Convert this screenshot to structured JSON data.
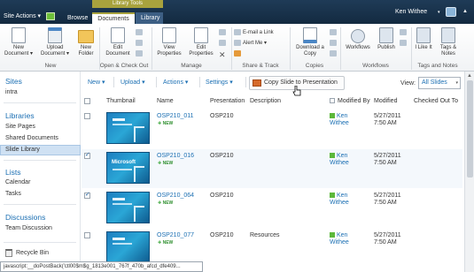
{
  "topbar": {
    "site_actions": "Site Actions ▾",
    "tabs": {
      "browse": "Browse",
      "documents": "Documents",
      "library": "Library"
    },
    "context_label": "Library Tools",
    "user_name": "Ken Withee",
    "user_caret": "▾"
  },
  "ribbon": {
    "new_document": "New Document ▾",
    "upload_document": "Upload Document ▾",
    "new_folder": "New Folder",
    "edit_document": "Edit Document",
    "view_properties": "View Properties",
    "edit_properties": "Edit Properties",
    "email_link": "E-mail a Link",
    "alert_me": "Alert Me ▾",
    "download_copy": "Download a Copy",
    "workflows": "Workflows",
    "publish": "Publish",
    "i_like_it": "I Like It",
    "tags_notes": "Tags & Notes",
    "groups": {
      "new": "New",
      "open_checkout": "Open & Check Out",
      "manage": "Manage",
      "share_track": "Share & Track",
      "copies": "Copies",
      "workflows": "Workflows",
      "tags_notes": "Tags and Notes"
    }
  },
  "leftnav": {
    "sites_heading": "Sites",
    "sites": [
      "intra"
    ],
    "libraries_heading": "Libraries",
    "libraries": [
      "Site Pages",
      "Shared Documents",
      "Slide Library"
    ],
    "lists_heading": "Lists",
    "lists": [
      "Calendar",
      "Tasks"
    ],
    "discussions_heading": "Discussions",
    "discussions": [
      "Team Discussion"
    ],
    "recycle_bin": "Recycle Bin"
  },
  "toolbar": {
    "new": "New ▾",
    "upload": "Upload ▾",
    "actions": "Actions ▾",
    "settings": "Settings ▾",
    "copy_slide": "Copy Slide to Presentation",
    "view_label": "View:",
    "view_value": "All Slides",
    "view_caret": "▾"
  },
  "columns": {
    "thumbnail": "Thumbnail",
    "name": "Name",
    "presentation": "Presentation",
    "description": "Description",
    "modified_by": "Modified By",
    "modified": "Modified",
    "checked_out_to": "Checked Out To"
  },
  "rows": [
    {
      "name": "OSP210_011",
      "new": "NEW",
      "presentation": "OSP210",
      "description": "",
      "modified_by_1": "Ken",
      "modified_by_2": "Withee",
      "date": "5/27/2011",
      "time": "7:50 AM",
      "checked": false,
      "thumb_title": ""
    },
    {
      "name": "OSP210_016",
      "new": "NEW",
      "presentation": "OSP210",
      "description": "",
      "modified_by_1": "Ken",
      "modified_by_2": "Withee",
      "date": "5/27/2011",
      "time": "7:50 AM",
      "checked": true,
      "thumb_title": "Microsoft"
    },
    {
      "name": "OSP210_064",
      "new": "NEW",
      "presentation": "OSP210",
      "description": "",
      "modified_by_1": "Ken",
      "modified_by_2": "Withee",
      "date": "5/27/2011",
      "time": "7:50 AM",
      "checked": true,
      "thumb_title": ""
    },
    {
      "name": "OSP210_077",
      "new": "NEW",
      "presentation": "OSP210",
      "description": "Resources",
      "modified_by_1": "Ken",
      "modified_by_2": "Withee",
      "date": "5/27/2011",
      "time": "7:50 AM",
      "checked": false,
      "thumb_title": ""
    }
  ],
  "statusbar": "javascript:__doPostBack('ctl00$m$g_1813e001_767f_470b_afcd_dfe409..."
}
